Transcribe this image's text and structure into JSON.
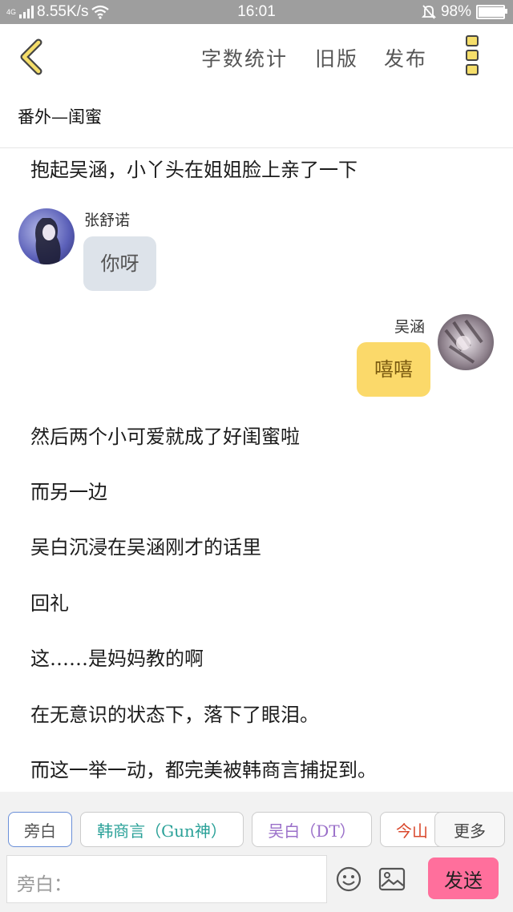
{
  "status_bar": {
    "network": "4G",
    "speed": "8.55K/s",
    "time": "16:01",
    "battery": "98%",
    "battery_level": 0.98
  },
  "header": {
    "word_count_label": "字数统计",
    "old_version_label": "旧版",
    "publish_label": "发布"
  },
  "chapter_title": "番外—闺蜜",
  "story": {
    "line_intro": "抱起吴涵，小丫头在姐姐脸上亲了一下",
    "msg_left": {
      "name": "张舒诺",
      "text": "你呀"
    },
    "msg_right": {
      "name": "吴涵",
      "text": "嘻嘻"
    },
    "lines": [
      "然后两个小可爱就成了好闺蜜啦",
      "而另一边",
      "吴白沉浸在吴涵刚才的话里",
      "回礼",
      "这……是妈妈教的啊",
      "在无意识的状态下，落下了眼泪。",
      "而这一举一动，都完美被韩商言捕捉到。"
    ]
  },
  "characters": [
    {
      "label": "旁白",
      "color": "#555555",
      "border": "#6a8fd8"
    },
    {
      "label": "韩商言（Gun神）",
      "color": "#2aa198",
      "border": "#cccccc"
    },
    {
      "label": "吴白（DT）",
      "color": "#9a6fc9",
      "border": "#cccccc"
    },
    {
      "label": "今山",
      "color": "#d9472b",
      "border": "#cccccc"
    }
  ],
  "more_label": "更多",
  "composer": {
    "placeholder": "旁白：",
    "send_label": "发送"
  },
  "colors": {
    "accent": "#f5de6a",
    "send": "#ff6f9c",
    "bubble_left": "#dde3ea",
    "bubble_right": "#fbd96a"
  }
}
